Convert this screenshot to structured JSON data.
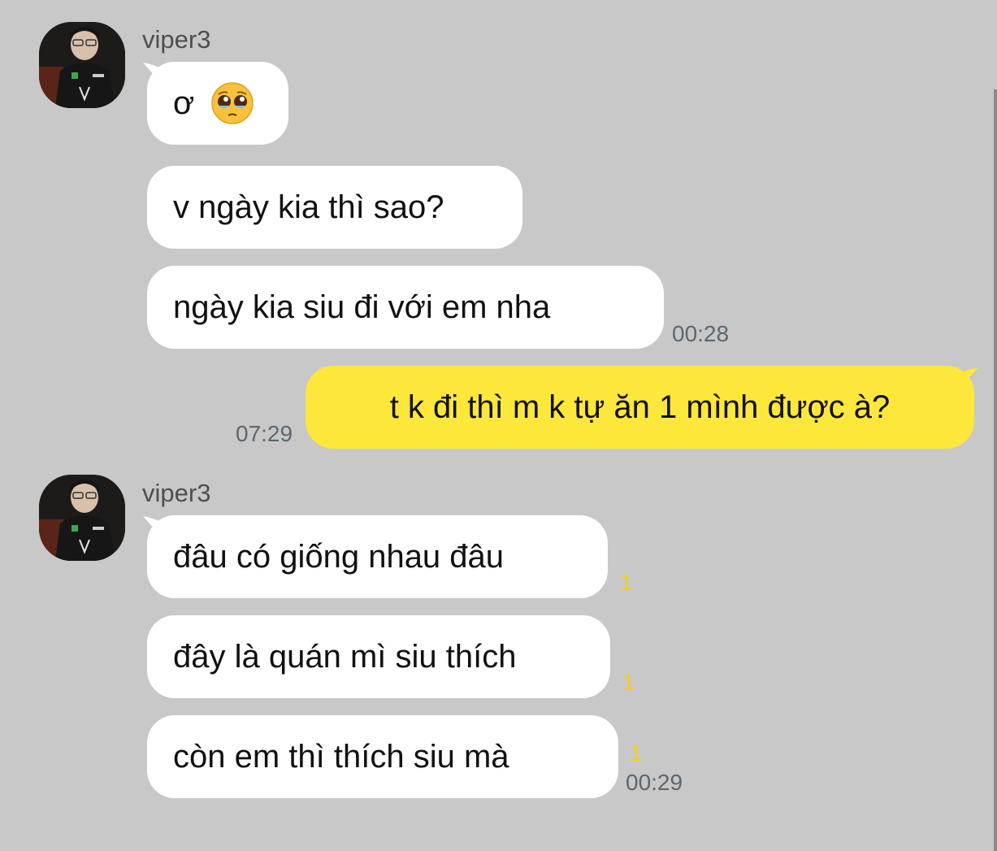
{
  "groups": [
    {
      "sender": "viper3",
      "avatar_icon": "profile-photo-icon"
    },
    {
      "sender": "viper3",
      "avatar_icon": "profile-photo-icon"
    }
  ],
  "messages": [
    {
      "text": "ơ",
      "emoji": "pleading-face-emoji"
    },
    {
      "text": "v ngày kia thì sao?"
    },
    {
      "text": "ngày kia siu đi với em nha",
      "time": "00:28"
    },
    {
      "text": "t k đi thì m k tự ăn 1 mình được à?",
      "time": "07:29"
    },
    {
      "text": "đâu có giống nhau đâu",
      "unread": "1"
    },
    {
      "text": "đây là quán mì siu thích",
      "unread": "1"
    },
    {
      "text": "còn em thì thích siu mà",
      "unread": "1",
      "time": "00:29"
    }
  ],
  "colors": {
    "background": "#c8c8c8",
    "incoming_bubble": "#ffffff",
    "outgoing_bubble": "#fde73a",
    "unread_count": "#f2cf1c",
    "timestamp": "#5d6770"
  }
}
